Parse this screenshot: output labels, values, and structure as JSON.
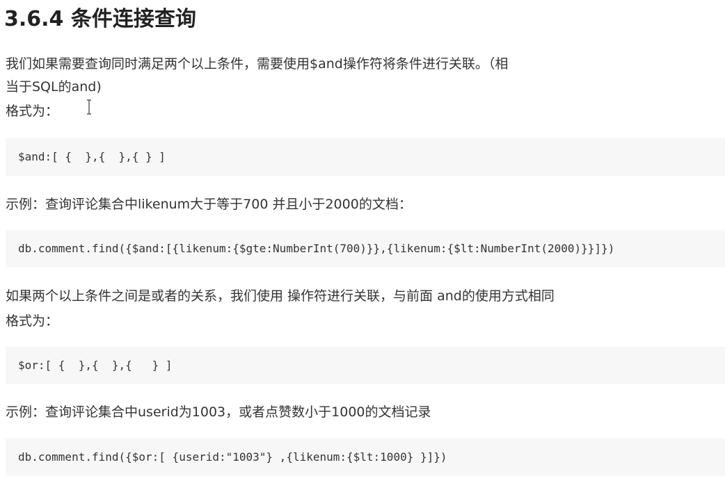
{
  "heading": "3.6.4 条件连接查询",
  "intro_line1": "我们如果需要查询同时满足两个以上条件，需要使用$and操作符将条件进行关联。（相",
  "intro_line2": "当于SQL的and)",
  "format_label_1": "格式为：",
  "code_and_format": "$and:[ {  },{  },{ } ]",
  "example_1_text": "示例：查询评论集合中likenum大于等于700 并且小于2000的文档：",
  "code_example_1": "db.comment.find({$and:[{likenum:{$gte:NumberInt(700)}},{likenum:{$lt:NumberInt(2000)}}]})",
  "or_intro": "如果两个以上条件之间是或者的关系，我们使用 操作符进行关联，与前面 and的使用方式相同",
  "format_label_2": "格式为：",
  "code_or_format": "$or:[ {  },{  },{   } ]",
  "example_2_text": "示例：查询评论集合中userid为1003，或者点赞数小于1000的文档记录",
  "code_example_2": "db.comment.find({$or:[ {userid:\"1003\"} ,{likenum:{$lt:1000} }]})",
  "icons": {
    "cursor": "text-cursor-icon"
  }
}
